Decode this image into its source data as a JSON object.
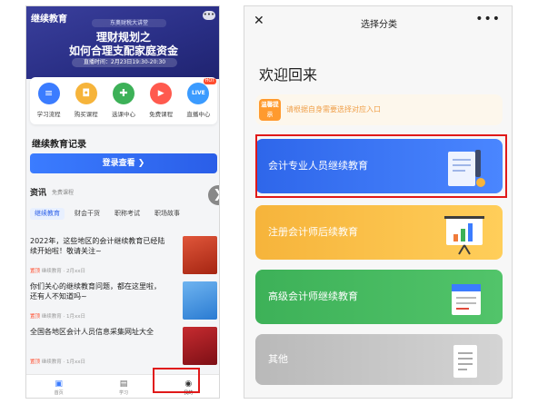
{
  "left": {
    "brand": "继续教育",
    "banner": {
      "ribbon": "东奥财税大讲堂",
      "title1": "理财规划之",
      "title2": "如何合理支配家庭资金",
      "time": "直播时间：2月23日19:30-20:30"
    },
    "quick_menu": [
      {
        "label": "学习流程",
        "icon": "book-icon",
        "color": "#3b7cff",
        "glyph": "≡"
      },
      {
        "label": "购买课程",
        "icon": "bag-icon",
        "color": "#f6b43b",
        "glyph": "◘"
      },
      {
        "label": "选课中心",
        "icon": "select-icon",
        "color": "#3db158",
        "glyph": "✚"
      },
      {
        "label": "免费课程",
        "icon": "play-icon",
        "color": "#ff5a4e",
        "glyph": "▶"
      },
      {
        "label": "直播中心",
        "icon": "live-icon",
        "color": "#3b9bff",
        "glyph": "LIVE",
        "badge": "HOT"
      }
    ],
    "record_title": "继续教育记录",
    "login_button": "登录查看",
    "news": {
      "heading": "资讯",
      "sub": "免费课程"
    },
    "tabs": [
      "继续教育",
      "财会干货",
      "职称考试",
      "职场故事"
    ],
    "articles": [
      {
        "title": "2022年，这些地区的会计继续教育已经陆续开始啦！敬请关注~",
        "tag": "置顶",
        "meta": "继续教育  ·  2月xx日",
        "thumb": "#c2371d"
      },
      {
        "title": "你们关心的继续教育问题，都在这里啦，还有人不知道吗~",
        "tag": "置顶",
        "meta": "继续教育  ·  1月xx日",
        "thumb": "#3d8fe0"
      },
      {
        "title": "全国各地区会计人员信息采集网址大全",
        "tag": "置顶",
        "meta": "继续教育  ·  1月xx日",
        "thumb": "#a81a22"
      }
    ],
    "bottom_nav": [
      {
        "label": "首页",
        "icon": "home-icon",
        "glyph": "▣"
      },
      {
        "label": "学习",
        "icon": "study-icon",
        "glyph": "▤"
      },
      {
        "label": "我的",
        "icon": "profile-icon",
        "glyph": "◉"
      }
    ]
  },
  "right": {
    "close": "✕",
    "title": "选择分类",
    "more": "•••",
    "welcome": "欢迎回来",
    "tip_badge": "温馨提示",
    "tip_text": "请根据自身需要选择对应入口",
    "cards": [
      {
        "label": "会计专业人员继续教育",
        "icon": "certificate-icon"
      },
      {
        "label": "注册会计师后续教育",
        "icon": "presentation-icon"
      },
      {
        "label": "高级会计师继续教育",
        "icon": "book-icon"
      },
      {
        "label": "其他",
        "icon": "document-icon"
      }
    ]
  }
}
